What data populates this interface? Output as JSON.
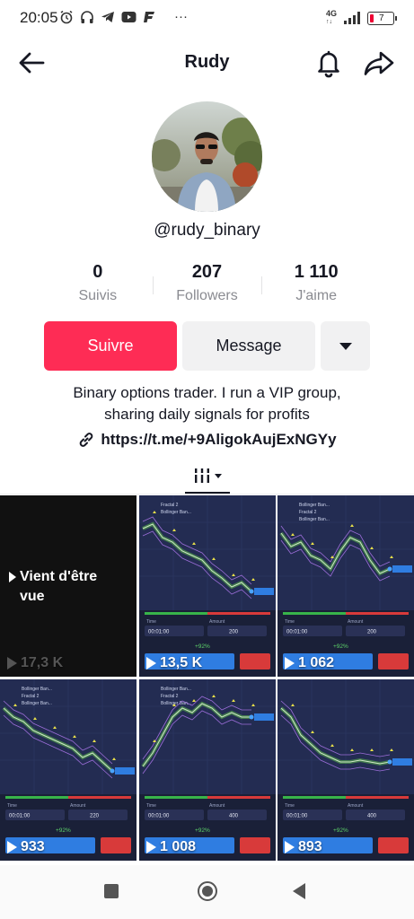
{
  "status_bar": {
    "time": "20:05",
    "network": "4G",
    "battery_level": "7",
    "overflow": "···"
  },
  "header": {
    "title": "Rudy"
  },
  "profile": {
    "username": "@rudy_binary",
    "stats": [
      {
        "value": "0",
        "label": "Suivis"
      },
      {
        "value": "207",
        "label": "Followers"
      },
      {
        "value": "1 110",
        "label": "J'aime"
      }
    ],
    "follow_label": "Suivre",
    "message_label": "Message",
    "bio_line1": "Binary options trader. I run a VIP group,",
    "bio_line2": "sharing daily signals for profits",
    "link": "https://t.me/+9AligokAujExNGYy"
  },
  "colors": {
    "follow": "#fe2c55",
    "secondary_button": "#f1f1f2",
    "text": "#161823",
    "muted": "#8a8b91"
  },
  "videos": [
    {
      "label": "Vient d'être vue",
      "views": "17,3 K"
    },
    {
      "views": "13,5 K",
      "chart_text": {
        "time_label": "Time",
        "time": "00:01:00",
        "amount_label": "Amount",
        "amount": "200",
        "payout": "+92%",
        "indicators": [
          "Fractal 2",
          "Bollinger Ban..."
        ]
      }
    },
    {
      "views": "1 062",
      "chart_text": {
        "time_label": "Time",
        "time": "00:01:00",
        "amount_label": "Amount",
        "amount": "200",
        "payout": "+92%",
        "indicators": [
          "Bollinger Ban...",
          "Fractal 2",
          "Bollinger Ban..."
        ]
      }
    },
    {
      "views": "933",
      "chart_text": {
        "time_label": "Time",
        "time": "00:01:00",
        "amount_label": "Amount",
        "amount": "220",
        "payout": "+92%",
        "indicators": [
          "Bollinger Ban...",
          "Fractal 2",
          "Bollinger Ban..."
        ]
      }
    },
    {
      "views": "1 008",
      "chart_text": {
        "time_label": "Time",
        "time": "00:01:00",
        "amount_label": "Amount",
        "amount": "400",
        "payout": "+92%",
        "indicators": [
          "Bollinger Ban...",
          "Fractal 2",
          "Bollinger Ban..."
        ]
      }
    },
    {
      "views": "893",
      "chart_text": {
        "time_label": "Time",
        "time": "00:01:00",
        "amount_label": "Amount",
        "amount": "400",
        "payout": "+92%",
        "indicators": []
      }
    }
  ],
  "icons": {
    "back": "arrow-left-icon",
    "bell": "bell-icon",
    "share": "share-icon",
    "link": "link-icon",
    "tab": "grid-filter-icon"
  }
}
